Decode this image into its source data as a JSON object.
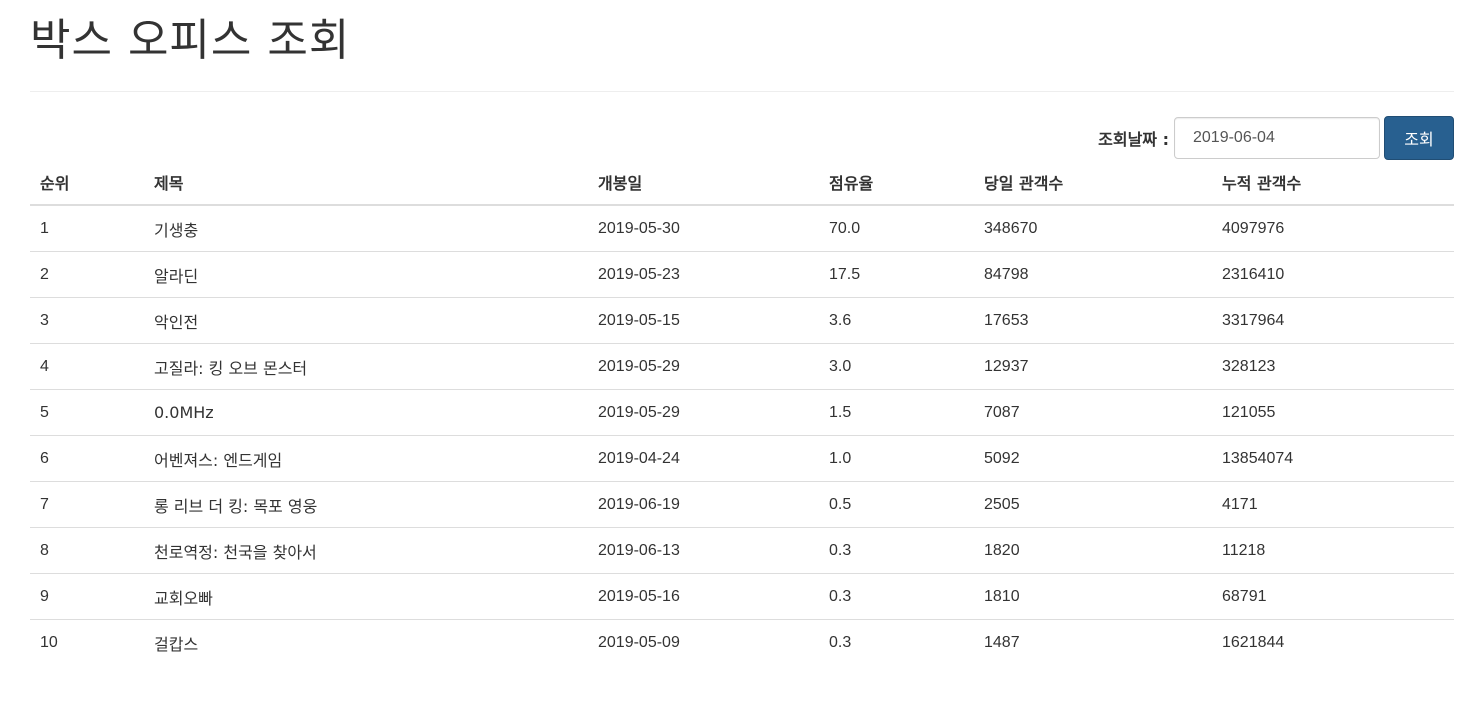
{
  "page": {
    "title": "박스 오피스 조회"
  },
  "search": {
    "label": "조회날짜 :",
    "date_value": "2019-06-04",
    "button_label": "조회"
  },
  "colors": {
    "primary_button": "#286090",
    "border": "#dddddd",
    "text": "#333333"
  },
  "table": {
    "headers": [
      "순위",
      "제목",
      "개봉일",
      "점유율",
      "당일 관객수",
      "누적 관객수"
    ],
    "rows": [
      {
        "rank": "1",
        "title": "기생충",
        "open_date": "2019-05-30",
        "share": "70.0",
        "daily_audience": "348670",
        "total_audience": "4097976"
      },
      {
        "rank": "2",
        "title": "알라딘",
        "open_date": "2019-05-23",
        "share": "17.5",
        "daily_audience": "84798",
        "total_audience": "2316410"
      },
      {
        "rank": "3",
        "title": "악인전",
        "open_date": "2019-05-15",
        "share": "3.6",
        "daily_audience": "17653",
        "total_audience": "3317964"
      },
      {
        "rank": "4",
        "title": "고질라: 킹 오브 몬스터",
        "open_date": "2019-05-29",
        "share": "3.0",
        "daily_audience": "12937",
        "total_audience": "328123"
      },
      {
        "rank": "5",
        "title": "0.0MHz",
        "open_date": "2019-05-29",
        "share": "1.5",
        "daily_audience": "7087",
        "total_audience": "121055"
      },
      {
        "rank": "6",
        "title": "어벤져스: 엔드게임",
        "open_date": "2019-04-24",
        "share": "1.0",
        "daily_audience": "5092",
        "total_audience": "13854074"
      },
      {
        "rank": "7",
        "title": "롱 리브 더 킹: 목포 영웅",
        "open_date": "2019-06-19",
        "share": "0.5",
        "daily_audience": "2505",
        "total_audience": "4171"
      },
      {
        "rank": "8",
        "title": "천로역정: 천국을 찾아서",
        "open_date": "2019-06-13",
        "share": "0.3",
        "daily_audience": "1820",
        "total_audience": "11218"
      },
      {
        "rank": "9",
        "title": "교회오빠",
        "open_date": "2019-05-16",
        "share": "0.3",
        "daily_audience": "1810",
        "total_audience": "68791"
      },
      {
        "rank": "10",
        "title": "걸캅스",
        "open_date": "2019-05-09",
        "share": "0.3",
        "daily_audience": "1487",
        "total_audience": "1621844"
      }
    ]
  }
}
